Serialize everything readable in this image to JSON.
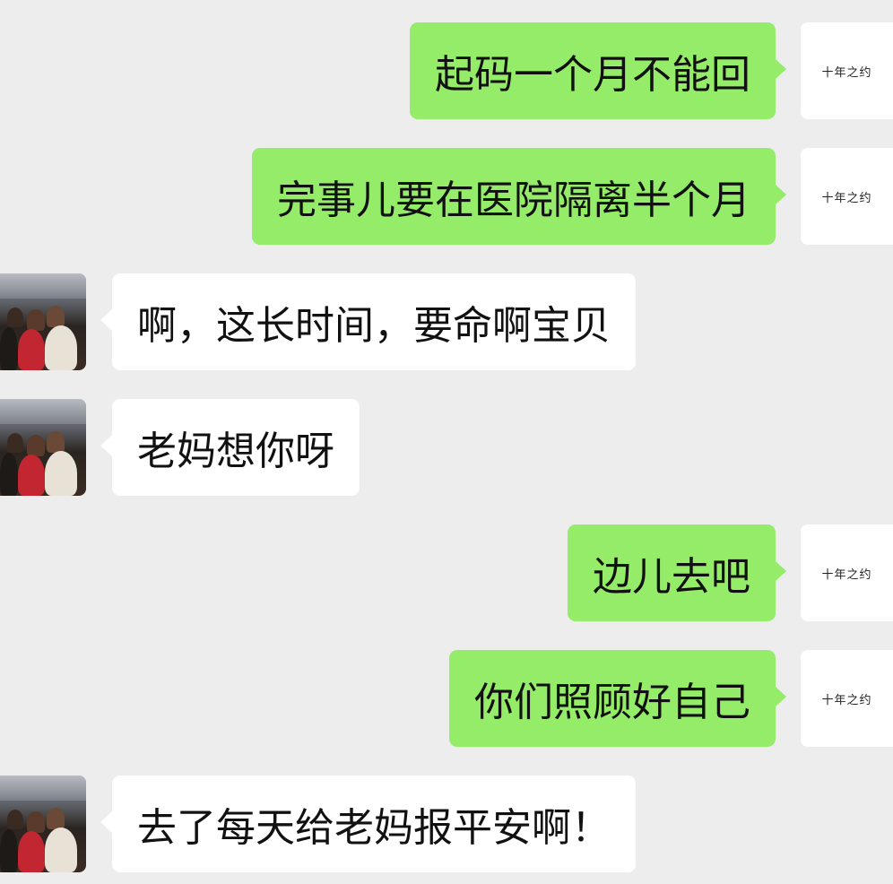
{
  "chat": {
    "contact_avatar_name": "十年之约",
    "messages": [
      {
        "side": "out",
        "text": "起码一个月不能回"
      },
      {
        "side": "out",
        "text": "完事儿要在医院隔离半个月"
      },
      {
        "side": "in",
        "text": "啊，这长时间，要命啊宝贝"
      },
      {
        "side": "in",
        "text": "老妈想你呀"
      },
      {
        "side": "out",
        "text": "边儿去吧"
      },
      {
        "side": "out",
        "text": "你们照顾好自己"
      },
      {
        "side": "in",
        "text": "去了每天给老妈报平安啊！"
      }
    ]
  },
  "colors": {
    "background": "#ededed",
    "outgoing_bubble": "#95ec69",
    "incoming_bubble": "#ffffff"
  }
}
